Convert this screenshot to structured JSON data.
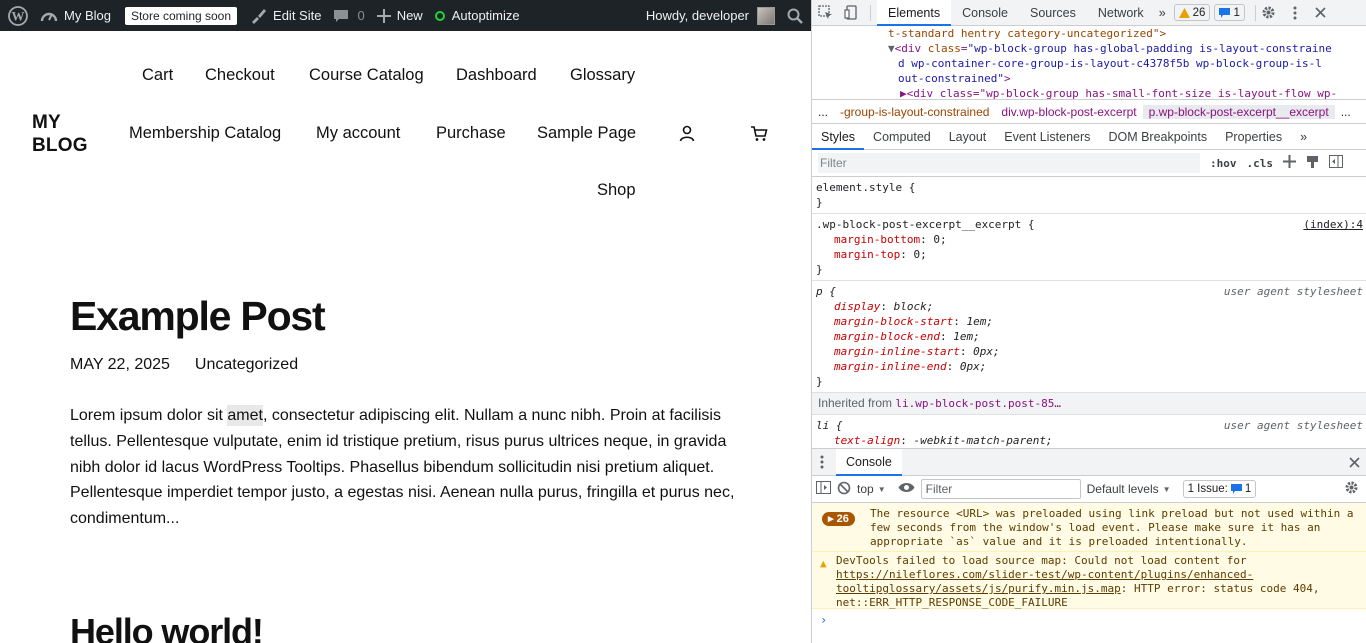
{
  "admin_bar": {
    "site_name": "My Blog",
    "store_badge": "Store coming soon",
    "edit_site": "Edit Site",
    "comments_count": "0",
    "new_label": "New",
    "autoptimize": "Autoptimize",
    "howdy": "Howdy, developer"
  },
  "site": {
    "logo_line1": "MY",
    "logo_line2": "BLOG",
    "nav": [
      "Cart",
      "Checkout",
      "Course Catalog",
      "Dashboard",
      "Glossary",
      "Membership Catalog",
      "My account",
      "Purchase",
      "Sample Page",
      "Shop"
    ]
  },
  "posts": [
    {
      "title": "Example Post",
      "date": "MAY 22, 2025",
      "category": "Uncategorized",
      "excerpt_before": "Lorem ipsum dolor sit ",
      "excerpt_highlight": "amet",
      "excerpt_after": ", consectetur adipiscing elit. Nullam a nunc nibh. Proin at facilisis tellus. Pellentesque vulputate, enim id tristique pretium, risus purus ultrices neque, in gravida nibh dolor id lacus WordPress Tooltips. Phasellus bibendum sollicitudin nisi pretium aliquet. Pellentesque imperdiet tempor justo, a egestas nisi. Aenean nulla purus, fringilla et purus nec, condimentum..."
    },
    {
      "title": "Hello world!"
    }
  ],
  "devtools": {
    "tabs": [
      "Elements",
      "Console",
      "Sources",
      "Network"
    ],
    "more": "»",
    "warnings_count": "26",
    "messages_count": "1",
    "dom_lines": {
      "l1": "t-standard hentry category-uncategorized\">",
      "l2_tag": "div",
      "l2_attr": "class",
      "l2_val": "\"wp-block-group has-global-padding is-layout-constraine",
      "l3_val": "d wp-container-core-group-is-layout-c4378f5b wp-block-group-is-l",
      "l4_val": "out-constrained\"",
      "l5": "▶<div class=\"wp-block-group has-small-font-size is-layout-flow wp-"
    },
    "breadcrumbs": [
      "...",
      "-group-is-layout-constrained",
      "div.wp-block-post-excerpt",
      "p.wp-block-post-excerpt__excerpt",
      "..."
    ],
    "sub_tabs": [
      "Styles",
      "Computed",
      "Layout",
      "Event Listeners",
      "DOM Breakpoints",
      "Properties",
      "»"
    ],
    "filter_placeholder": "Filter",
    "hov": ":hov",
    "cls": ".cls",
    "rules": {
      "element_style": "element.style {",
      "close": "}",
      "excerpt_selector": ".wp-block-post-excerpt__excerpt {",
      "excerpt_origin": "(index):4",
      "excerpt_props": [
        {
          "name": "margin-bottom",
          "value": "0;"
        },
        {
          "name": "margin-top",
          "value": "0;"
        }
      ],
      "p_selector": "p {",
      "ua_origin": "user agent stylesheet",
      "p_props": [
        {
          "name": "display",
          "value": "block;"
        },
        {
          "name": "margin-block-start",
          "value": "1em;"
        },
        {
          "name": "margin-block-end",
          "value": "1em;"
        },
        {
          "name": "margin-inline-start",
          "value": "0px;"
        },
        {
          "name": "margin-inline-end",
          "value": "0px;"
        }
      ],
      "inherited_label": "Inherited from",
      "inherited_from": "li.wp-block-post.post-85…",
      "li_selector": "li {",
      "li_prop": {
        "name": "text-align",
        "value": "-webkit-match-parent;"
      }
    },
    "drawer": {
      "tab": "Console",
      "context": "top",
      "filter_placeholder": "Filter",
      "levels": "Default levels",
      "issues_label": "1 Issue:",
      "issues_count": "1",
      "msg1_count": "26",
      "msg1": "The resource <URL> was preloaded using link preload but not used within a few seconds from the window's load event. Please make sure it has an appropriate `as` value and it is preloaded intentionally.",
      "msg2_prefix": "DevTools failed to load source map: Could not load content for ",
      "msg2_link": "https://nileflores.com/slider-test/wp-content/plugins/enhanced-tooltipglossary/assets/js/purify.min.js.map",
      "msg2_suffix": ": HTTP error: status code 404, net::ERR_HTTP_RESPONSE_CODE_FAILURE",
      "prompt": "›"
    }
  }
}
